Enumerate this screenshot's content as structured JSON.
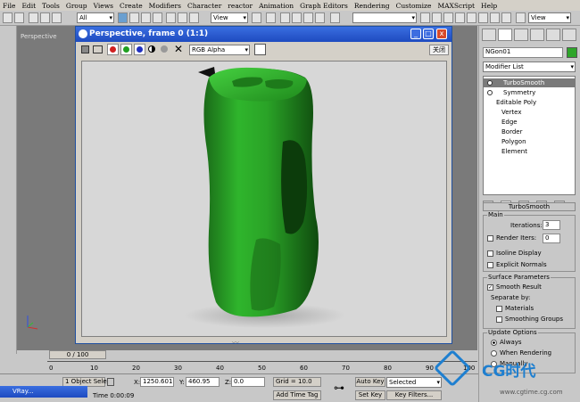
{
  "menu": [
    "File",
    "Edit",
    "Tools",
    "Group",
    "Views",
    "Create",
    "Modifiers",
    "Character",
    "reactor",
    "Animation",
    "Graph Editors",
    "Rendering",
    "Customize",
    "MAXScript",
    "Help"
  ],
  "toolbar": {
    "selection_filter": "All",
    "ref_coord": "View",
    "ref_coord_right": "View"
  },
  "viewport": {
    "label": "Perspective"
  },
  "vfb": {
    "title": "Perspective, frame 0 (1:1)",
    "channel": "RGB Alpha",
    "close_label": "关闭",
    "minimize": "_",
    "maximize": "□",
    "close": "x",
    "object_color": "#2ea52a"
  },
  "panel": {
    "object_name": "NGon01",
    "modifier_list": "Modifier List",
    "stack": [
      {
        "label": "TurboSmooth",
        "selected": true,
        "depth": 0
      },
      {
        "label": "Symmetry",
        "selected": false,
        "depth": 0
      },
      {
        "label": "Editable Poly",
        "selected": false,
        "depth": 0
      },
      {
        "label": "Vertex",
        "selected": false,
        "depth": 1
      },
      {
        "label": "Edge",
        "selected": false,
        "depth": 1
      },
      {
        "label": "Border",
        "selected": false,
        "depth": 1
      },
      {
        "label": "Polygon",
        "selected": false,
        "depth": 1
      },
      {
        "label": "Element",
        "selected": false,
        "depth": 1
      }
    ],
    "turbosmooth": {
      "header": "TurboSmooth",
      "main": "Main",
      "iterations_label": "Iterations:",
      "iterations": "3",
      "render_iters_label": "Render Iters:",
      "render_iters": "0",
      "isoline": "Isoline Display",
      "explicit": "Explicit Normals",
      "surface": "Surface Parameters",
      "smooth_result": "Smooth Result",
      "separate_by": "Separate by:",
      "materials": "Materials",
      "smoothing_groups": "Smoothing Groups",
      "update_options": "Update Options",
      "always": "Always",
      "when_rendering": "When Rendering",
      "manually": "Manually"
    }
  },
  "timeline": {
    "frame": "0 / 100",
    "ticks": [
      "0",
      "10",
      "20",
      "30",
      "40",
      "50",
      "60",
      "70",
      "80",
      "90",
      "100"
    ]
  },
  "status": {
    "selection": "1 Object Sele",
    "x_label": "X:",
    "x": "1250.601",
    "y_label": "Y:",
    "y": "460.95",
    "z_label": "Z:",
    "z": "0.0",
    "grid": "Grid = 10.0",
    "auto_key": "Auto Key",
    "set_key": "Set Key",
    "selected": "Selected",
    "key_filters": "Key Filters...",
    "add_time_tag": "Add Time Tag",
    "render_time": "Time  0:00:09",
    "taskbar": "VRay..."
  },
  "watermark": {
    "brand": "CG时代",
    "url": "www.cgtime.cg.com"
  }
}
